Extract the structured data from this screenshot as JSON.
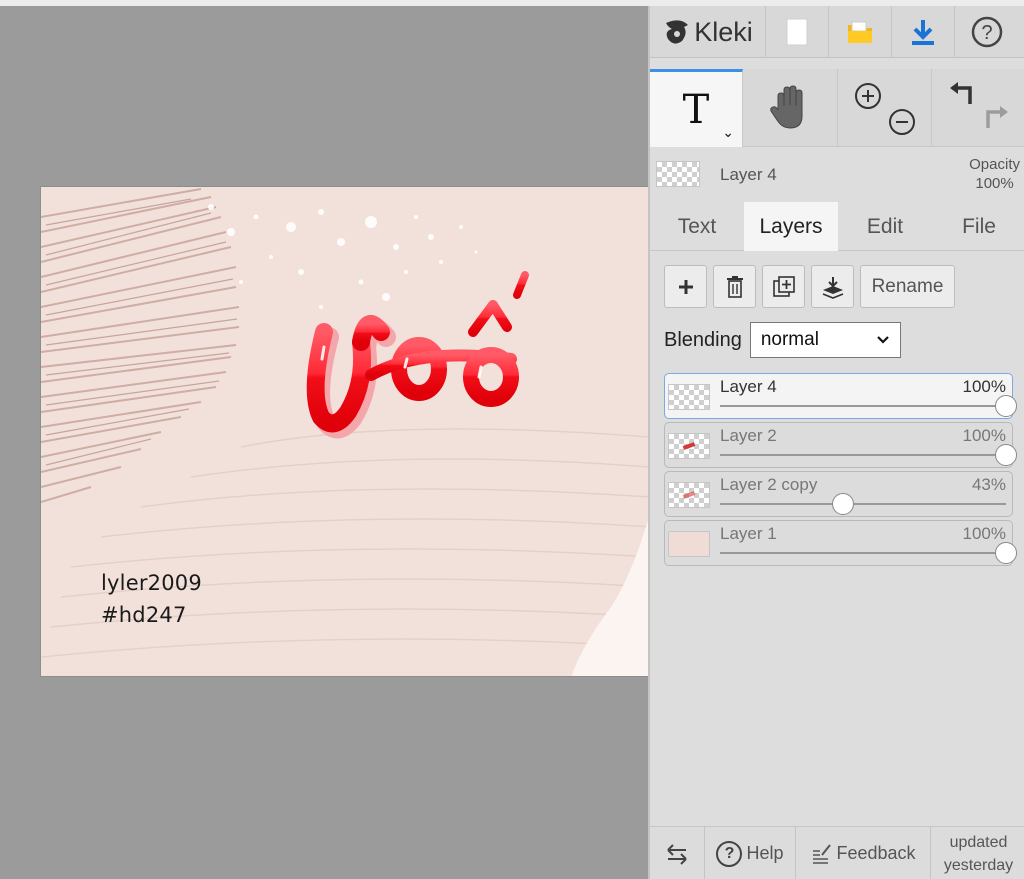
{
  "app": {
    "name": "Kleki"
  },
  "canvas": {
    "big_text": "ườ",
    "signature_line1": "lyler2009",
    "signature_line2": "#hd247"
  },
  "toolbar": {
    "new_icon": "new-file-icon",
    "open_icon": "open-folder-icon",
    "download_icon": "download-icon",
    "help_icon": "help-icon"
  },
  "tools": {
    "text_tool_label": "T",
    "chevron": "⌄"
  },
  "current_layer": {
    "name": "Layer 4",
    "opacity_label": "Opacity",
    "opacity_value": "100%"
  },
  "tabs": [
    {
      "label": "Text",
      "active": false
    },
    {
      "label": "Layers",
      "active": true
    },
    {
      "label": "Edit",
      "active": false
    },
    {
      "label": "File",
      "active": false
    }
  ],
  "layer_buttons": {
    "rename": "Rename"
  },
  "blending": {
    "label": "Blending",
    "value": "normal"
  },
  "layers": [
    {
      "name": "Layer 4",
      "opacity": "100%",
      "opacity_fraction": 1.0,
      "selected": true
    },
    {
      "name": "Layer 2",
      "opacity": "100%",
      "opacity_fraction": 1.0,
      "selected": false
    },
    {
      "name": "Layer 2 copy",
      "opacity": "43%",
      "opacity_fraction": 0.43,
      "selected": false
    },
    {
      "name": "Layer 1",
      "opacity": "100%",
      "opacity_fraction": 1.0,
      "selected": false
    }
  ],
  "bottom": {
    "help": "Help",
    "feedback": "Feedback",
    "updated_line1": "updated",
    "updated_line2": "yesterday"
  },
  "colors": {
    "accent": "#3f8fe8",
    "canvas_bg": "#f2e1db",
    "text_red": "#e8202a"
  }
}
